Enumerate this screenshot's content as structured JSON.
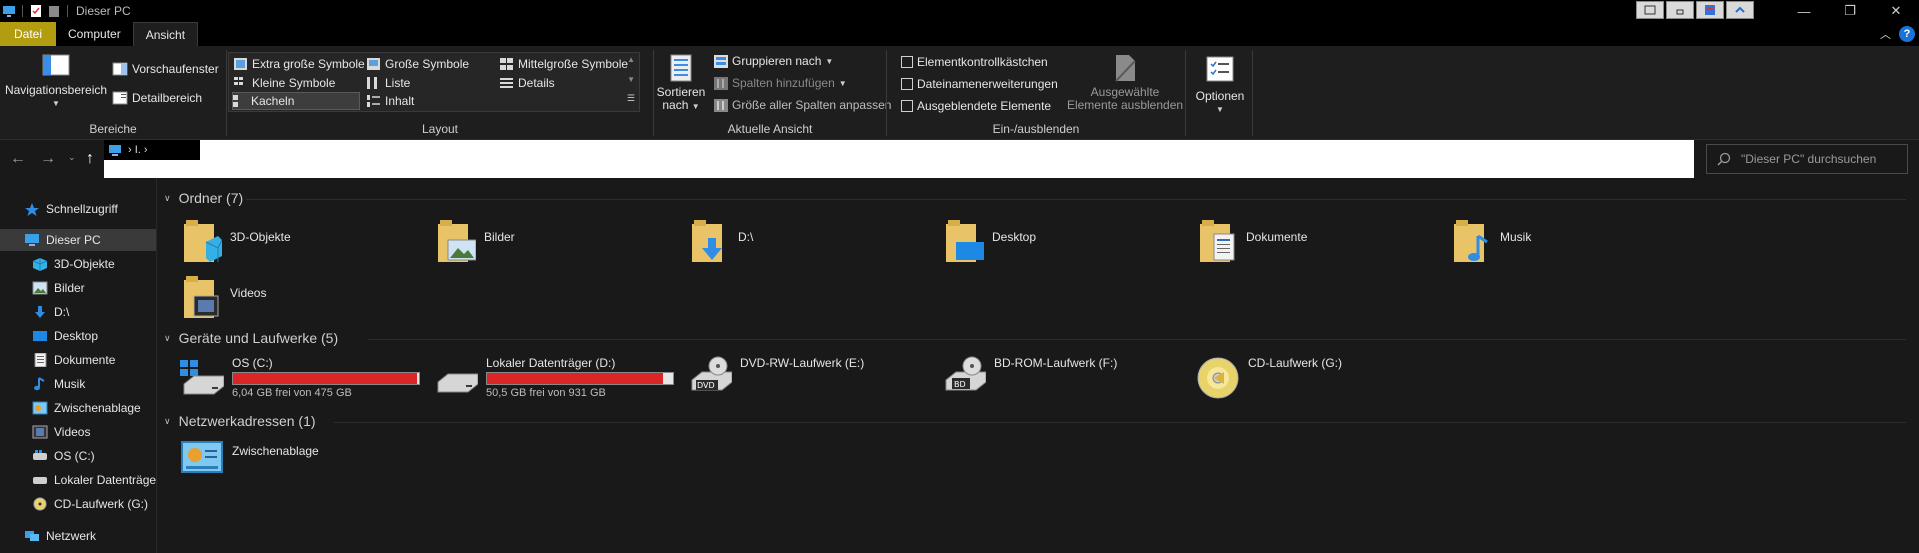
{
  "window": {
    "title": "Dieser PC"
  },
  "tabs": [
    {
      "label": "Datei"
    },
    {
      "label": "Computer"
    },
    {
      "label": "Ansicht"
    }
  ],
  "ribbon": {
    "bereiche": {
      "label": "Bereiche",
      "navigation": "Navigationsbereich",
      "preview": "Vorschaufenster",
      "details": "Detailbereich"
    },
    "layout": {
      "label": "Layout",
      "items": [
        "Extra große Symbole",
        "Große Symbole",
        "Mittelgroße Symbole",
        "Kleine Symbole",
        "Liste",
        "Details",
        "Kacheln",
        "Inhalt"
      ],
      "selected": "Kacheln"
    },
    "current_view": {
      "label": "Aktuelle Ansicht",
      "sort": "Sortieren",
      "sort2": "nach",
      "group": "Gruppieren nach",
      "add_columns": "Spalten hinzufügen",
      "fit_columns": "Größe aller Spalten anpassen"
    },
    "show_hide": {
      "label": "Ein-/ausblenden",
      "checkboxes": "Elementkontrollkästchen",
      "extensions": "Dateinamenerweiterungen",
      "hidden": "Ausgeblendete Elemente",
      "hide_selected_1": "Ausgewählte",
      "hide_selected_2": "Elemente ausblenden"
    },
    "options": {
      "label": "Optionen"
    }
  },
  "address": {
    "crumb": "›  I.  ›"
  },
  "search": {
    "placeholder": "\"Dieser PC\" durchsuchen"
  },
  "sidebar": [
    {
      "label": "Schnellzugriff",
      "icon": "star-icon"
    },
    {
      "label": "Dieser PC",
      "icon": "computer-icon",
      "selected": true
    },
    {
      "label": "3D-Objekte",
      "icon": "cube-icon"
    },
    {
      "label": "Bilder",
      "icon": "pictures-icon"
    },
    {
      "label": "D:\\",
      "icon": "download-icon"
    },
    {
      "label": "Desktop",
      "icon": "desktop-icon"
    },
    {
      "label": "Dokumente",
      "icon": "documents-icon"
    },
    {
      "label": "Musik",
      "icon": "music-icon"
    },
    {
      "label": "Zwischenablage",
      "icon": "network-location-icon"
    },
    {
      "label": "Videos",
      "icon": "videos-icon"
    },
    {
      "label": "OS (C:)",
      "icon": "drive-icon"
    },
    {
      "label": "Lokaler Datenträger",
      "icon": "drive-icon"
    },
    {
      "label": "CD-Laufwerk (G:)",
      "icon": "cd-icon"
    },
    {
      "label": "Netzwerk",
      "icon": "network-icon"
    }
  ],
  "sections": {
    "folders": {
      "title": "Ordner (7)",
      "items": [
        "3D-Objekte",
        "Bilder",
        "D:\\",
        "Desktop",
        "Dokumente",
        "Musik",
        "Videos"
      ]
    },
    "drives": {
      "title": "Geräte und Laufwerke (5)",
      "items": [
        {
          "name": "OS (C:)",
          "free": "6,04 GB frei von 475 GB",
          "used_fraction": 0.987
        },
        {
          "name": "Lokaler Datenträger (D:)",
          "free": "50,5 GB frei von 931 GB",
          "used_fraction": 0.946
        },
        {
          "name": "DVD-RW-Laufwerk (E:)"
        },
        {
          "name": "BD-ROM-Laufwerk (F:)"
        },
        {
          "name": "CD-Laufwerk (G:)"
        }
      ]
    },
    "network": {
      "title": "Netzwerkadressen (1)",
      "items": [
        "Zwischenablage"
      ]
    }
  },
  "colors": {
    "file_tab": "#b29c10",
    "drive_bar": "#da2626",
    "background": "#191919"
  }
}
